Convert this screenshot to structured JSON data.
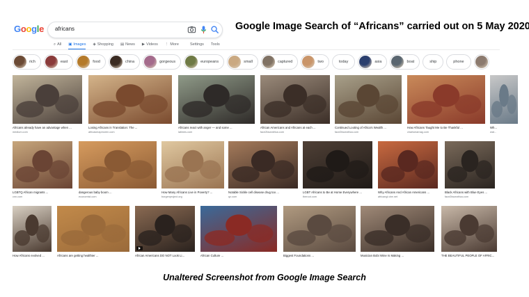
{
  "logo": [
    "G",
    "o",
    "o",
    "g",
    "l",
    "e"
  ],
  "logo_colors": [
    "#4285f4",
    "#ea4335",
    "#fbbc05",
    "#4285f4",
    "#34a853",
    "#ea4335"
  ],
  "search": {
    "query": "africans"
  },
  "caption": {
    "title": "Google Image Search of “Africans” carried out on 5 May 2020",
    "footer": "Unaltered Screenshot from Google Image Search"
  },
  "tabs": [
    {
      "label": "All",
      "icon": "search-icon",
      "active": false
    },
    {
      "label": "Images",
      "icon": "image-icon",
      "active": true
    },
    {
      "label": "Shopping",
      "icon": "tag-icon",
      "active": false
    },
    {
      "label": "News",
      "icon": "news-icon",
      "active": false
    },
    {
      "label": "Videos",
      "icon": "video-icon",
      "active": false
    },
    {
      "label": "More",
      "icon": "more-icon",
      "active": false
    }
  ],
  "tools": {
    "settings": "Settings",
    "tools": "Tools"
  },
  "chips": [
    {
      "label": "rich",
      "color": "#6b4a35"
    },
    {
      "label": "east",
      "color": "#8a3b3b"
    },
    {
      "label": "food",
      "color": "#b47a2a"
    },
    {
      "label": "china",
      "color": "#3a2b22"
    },
    {
      "label": "gorgeous",
      "color": "#a46b8c"
    },
    {
      "label": "europeans",
      "color": "#6f7a45"
    },
    {
      "label": "small",
      "color": "#caa982"
    },
    {
      "label": "captured",
      "color": "#807264"
    },
    {
      "label": "two",
      "color": "#c9956a"
    },
    {
      "label": "today",
      "color": ""
    },
    {
      "label": "asia",
      "color": "#2b3f6e"
    },
    {
      "label": "boat",
      "color": "#5a6670"
    },
    {
      "label": "ship",
      "color": ""
    },
    {
      "label": "phone",
      "color": ""
    },
    {
      "label": "",
      "color": "#8b7a6e"
    }
  ],
  "rows": [
    [
      {
        "caption": "Africans already have an advantage when ...",
        "source": "medium.com",
        "c1": "#4a3f3a",
        "c2": "#c2b59b"
      },
      {
        "caption": "Losing Africans in Translation: The ...",
        "source": "africasmapmoren.com",
        "c1": "#7a4a2e",
        "c2": "#d4b48a"
      },
      {
        "caption": "Africans react with anger — and some ...",
        "source": "latimes.com",
        "c1": "#2e2a28",
        "c2": "#8f9a88"
      },
      {
        "caption": "African Americans and Africans at each ...",
        "source": "face2faceafrica.com",
        "c1": "#3b2e27",
        "c2": "#9a8a7a"
      },
      {
        "caption": "Continued Looting of Africa's Wealth ...",
        "source": "face2faceafrica.com",
        "c1": "#5a4634",
        "c2": "#a8a08a"
      },
      {
        "caption": "How Africans Taught Me to Be Thankful ...",
        "source": "charismamag.com",
        "c1": "#8a3a2a",
        "c2": "#c98a5a"
      },
      {
        "caption": "Wh...",
        "source": "wat...",
        "c1": "#6a7a88",
        "c2": "#c8c8c8"
      }
    ],
    [
      {
        "caption": "LGBTQ African migrants ...",
        "source": "cnn.com",
        "c1": "#6a4434",
        "c2": "#c7a67c"
      },
      {
        "caption": "dangerous baby boom ...",
        "source": "economist.com",
        "c1": "#8a5a34",
        "c2": "#d69b5e"
      },
      {
        "caption": "How Many Africans Live in Poverty? ...",
        "source": "borgenproject.org",
        "c1": "#9a7452",
        "c2": "#e0c8a0"
      },
      {
        "caption": "Notable Sickle cell disease drug too ...",
        "source": "qz.com",
        "c1": "#3a2a24",
        "c2": "#a57b5b"
      },
      {
        "caption": "LGBT Africans to Be at Home Everywhere ...",
        "source": "theroot.com",
        "c1": "#1f1a17",
        "c2": "#4f4036"
      },
      {
        "caption": "Why Africans And African Americans ...",
        "source": "africangl obe.net",
        "c1": "#5a2820",
        "c2": "#c86a40"
      },
      {
        "caption": "Black Africans with Blue Eyes ...",
        "source": "face2faceafrica.com",
        "c1": "#2a2420",
        "c2": "#7a6a5a"
      }
    ],
    [
      {
        "caption": "How Africans evolved ...",
        "source": "",
        "c1": "#4a3a30",
        "c2": "#d8cfc2"
      },
      {
        "caption": "Africans are getting healthier ...",
        "source": "",
        "c1": "#9a6a3a",
        "c2": "#c28a4a"
      },
      {
        "caption": "African Americans DO NOT Look Li...",
        "source": "",
        "c1": "#2a221e",
        "c2": "#8a6a52"
      },
      {
        "caption": "African Culture ...",
        "source": "",
        "c1": "#8a2a24",
        "c2": "#3a6a9a"
      },
      {
        "caption": "Biggest Foundations ...",
        "source": "",
        "c1": "#5a4a40",
        "c2": "#b09a80"
      },
      {
        "caption": "Musician Bobi Wine Is Making ...",
        "source": "",
        "c1": "#3a2e28",
        "c2": "#a08a78"
      },
      {
        "caption": "THE BEAUTIFUL PEOPLE OF AFRIC...",
        "source": "",
        "c1": "#4a3a32",
        "c2": "#c8b8a8"
      }
    ]
  ]
}
